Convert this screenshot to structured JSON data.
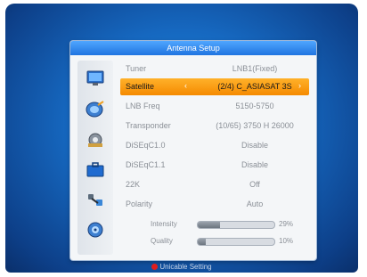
{
  "window": {
    "title": "Antenna Setup"
  },
  "settings": [
    {
      "label": "Tuner",
      "value": "LNB1(Fixed)",
      "selected": false
    },
    {
      "label": "Satellite",
      "value": "(2/4) C_ASIASAT 3S",
      "selected": true
    },
    {
      "label": "LNB Freq",
      "value": "5150-5750",
      "selected": false
    },
    {
      "label": "Transponder",
      "value": "(10/65) 3750 H 26000",
      "selected": false
    },
    {
      "label": "DiSEqC1.0",
      "value": "Disable",
      "selected": false
    },
    {
      "label": "DiSEqC1.1",
      "value": "Disable",
      "selected": false
    },
    {
      "label": "22K",
      "value": "Off",
      "selected": false
    },
    {
      "label": "Polarity",
      "value": "Auto",
      "selected": false
    }
  ],
  "arrows": {
    "left": "‹",
    "right": "›"
  },
  "meters": [
    {
      "label": "Intensity",
      "percent_text": "29%",
      "level": 0.29
    },
    {
      "label": "Quality",
      "percent_text": "10%",
      "level": 0.1
    }
  ],
  "footer": {
    "hint": "Unicable Setting",
    "key_color": "#e21d1d"
  },
  "colors": {
    "selection": "#f58a00",
    "title_bar": "#1f74e0",
    "background": "#1668c0"
  },
  "side_icons": [
    "monitor-icon",
    "satellite-dish-icon",
    "gear-icon",
    "briefcase-icon",
    "tools-icon",
    "disc-icon"
  ]
}
